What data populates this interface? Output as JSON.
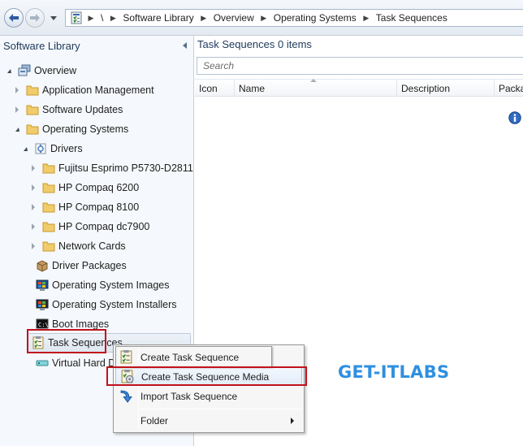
{
  "breadcrumb": {
    "root": "\\",
    "items": [
      "Software Library",
      "Overview",
      "Operating Systems",
      "Task Sequences"
    ]
  },
  "left_pane": {
    "title": "Software Library",
    "tree": [
      {
        "label": "Overview",
        "icon": "overview-icon"
      },
      {
        "label": "Application Management",
        "icon": "folder-icon"
      },
      {
        "label": "Software Updates",
        "icon": "folder-icon"
      },
      {
        "label": "Operating Systems",
        "icon": "folder-icon"
      },
      {
        "label": "Drivers",
        "icon": "drivers-icon"
      },
      {
        "label": "Fujitsu Esprimo P5730-D2811",
        "icon": "folder-icon"
      },
      {
        "label": "HP Compaq 6200",
        "icon": "folder-icon"
      },
      {
        "label": "HP Compaq 8100",
        "icon": "folder-icon"
      },
      {
        "label": "HP Compaq dc7900",
        "icon": "folder-icon"
      },
      {
        "label": "Network Cards",
        "icon": "folder-icon"
      },
      {
        "label": "Driver Packages",
        "icon": "driver-package-icon"
      },
      {
        "label": "Operating System Images",
        "icon": "os-image-icon"
      },
      {
        "label": "Operating System Installers",
        "icon": "os-installer-icon"
      },
      {
        "label": "Boot Images",
        "icon": "boot-image-icon"
      },
      {
        "label": "Task Sequences",
        "icon": "task-sequence-icon"
      },
      {
        "label": "Virtual Hard D",
        "icon": "virtual-disk-icon"
      }
    ]
  },
  "right_pane": {
    "title": "Task Sequences 0 items",
    "search_placeholder": "Search",
    "columns": [
      "Icon",
      "Name",
      "Description",
      "Package"
    ]
  },
  "context_menu": {
    "items": [
      {
        "label": "Create Task Sequence",
        "icon": "create-task-sequence-icon"
      },
      {
        "label": "Create Task Sequence Media",
        "icon": "create-media-icon"
      },
      {
        "label": "Import Task Sequence",
        "icon": "import-arrow-icon"
      },
      {
        "label": "Folder",
        "icon": ""
      }
    ]
  },
  "watermark": "GET-ITLABS",
  "colors": {
    "highlight_red": "#c0121b",
    "watermark_blue": "#2f8fe0",
    "pane_title": "#1e395b"
  }
}
